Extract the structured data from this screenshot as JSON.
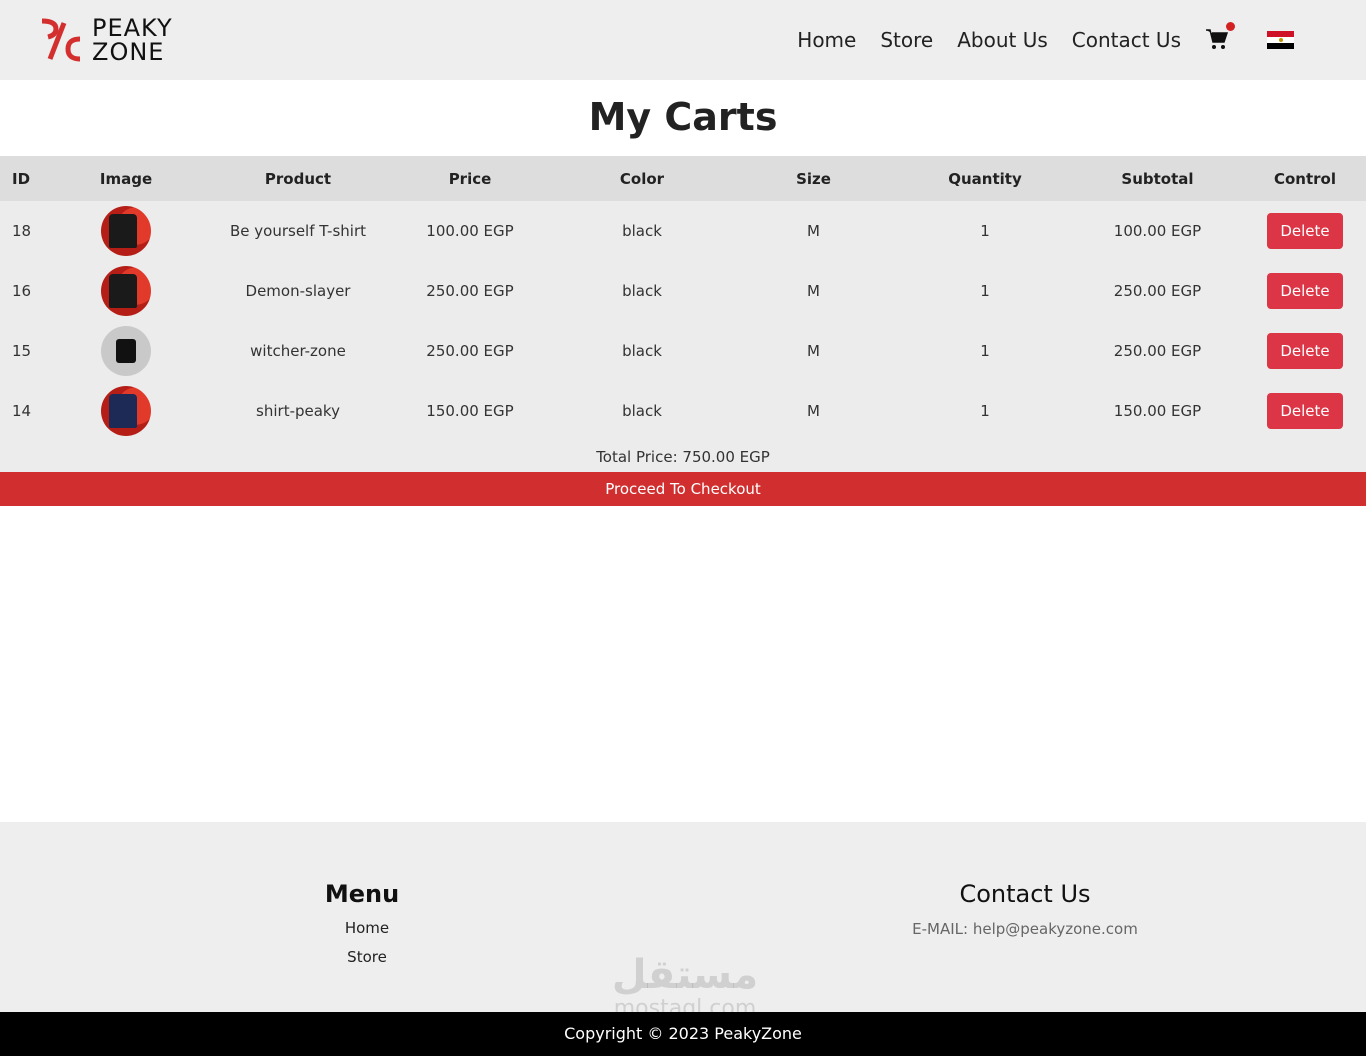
{
  "brand": {
    "logo_line1": "PEAKY",
    "logo_line2": "ZONE",
    "accent": "#d32f2f"
  },
  "nav": {
    "items": [
      {
        "label": "Home"
      },
      {
        "label": "Store"
      },
      {
        "label": "About Us"
      },
      {
        "label": "Contact Us"
      }
    ],
    "cart_icon": "cart-icon",
    "flag": "egypt-flag-icon"
  },
  "page": {
    "title": "My Carts"
  },
  "table": {
    "headers": [
      "ID",
      "Image",
      "Product",
      "Price",
      "Color",
      "Size",
      "Quantity",
      "Subtotal",
      "Control"
    ],
    "rows": [
      {
        "id": "18",
        "product": "Be yourself T-shirt",
        "price": "100.00 EGP",
        "color": "black",
        "size": "M",
        "quantity": "1",
        "subtotal": "100.00 EGP",
        "action": "Delete"
      },
      {
        "id": "16",
        "product": "Demon-slayer",
        "price": "250.00 EGP",
        "color": "black",
        "size": "M",
        "quantity": "1",
        "subtotal": "250.00 EGP",
        "action": "Delete"
      },
      {
        "id": "15",
        "product": "witcher-zone",
        "price": "250.00 EGP",
        "color": "black",
        "size": "M",
        "quantity": "1",
        "subtotal": "250.00 EGP",
        "action": "Delete"
      },
      {
        "id": "14",
        "product": "shirt-peaky",
        "price": "150.00 EGP",
        "color": "black",
        "size": "M",
        "quantity": "1",
        "subtotal": "150.00 EGP",
        "action": "Delete"
      }
    ]
  },
  "summary": {
    "total": "Total Price: 750.00 EGP",
    "checkout": "Proceed To Checkout"
  },
  "footer": {
    "menu_title": "Menu",
    "menu_items": [
      {
        "label": "Home"
      },
      {
        "label": "Store"
      }
    ],
    "contact_title": "Contact Us",
    "contact_email": "E-MAIL: help@peakyzone.com",
    "watermark_ar": "مستقل",
    "watermark_en": "mostaql.com",
    "copyright": "Copyright © 2023 PeakyZone"
  }
}
